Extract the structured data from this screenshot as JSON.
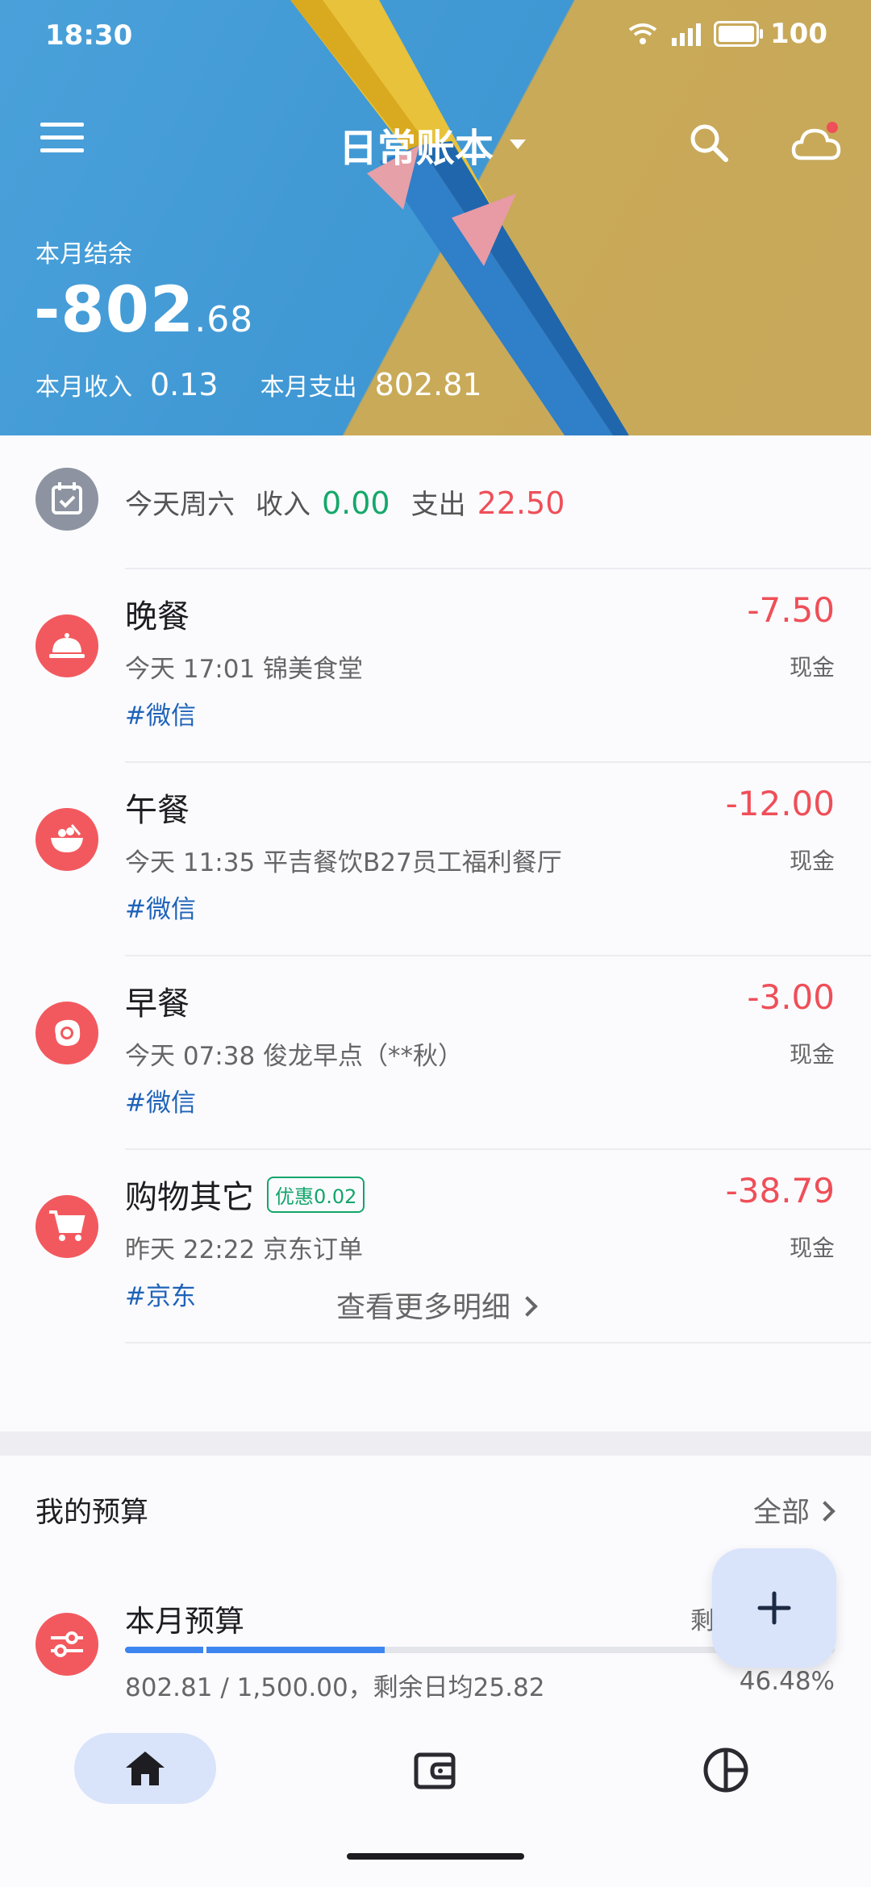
{
  "status": {
    "time": "18:30",
    "battery": "100"
  },
  "header": {
    "book_title": "日常账本",
    "balance_label": "本月结余",
    "balance_int": "-802",
    "balance_dec": ".68",
    "income_label": "本月收入",
    "income_value": "0.13",
    "expense_label": "本月支出",
    "expense_value": "802.81"
  },
  "today": {
    "label": "今天周六",
    "income_label": "收入",
    "income_value": "0.00",
    "expense_label": "支出",
    "expense_value": "22.50"
  },
  "transactions": [
    {
      "name": "晚餐",
      "sub": "今天 17:01 锦美食堂",
      "tag": "#微信",
      "amount": "-7.50",
      "account": "现金",
      "icon": "dome-icon"
    },
    {
      "name": "午餐",
      "sub": "今天 11:35 平吉餐饮B27员工福利餐厅",
      "tag": "#微信",
      "amount": "-12.00",
      "account": "现金",
      "icon": "bowl-icon"
    },
    {
      "name": "早餐",
      "sub": "今天 07:38 俊龙早点（**秋）",
      "tag": "#微信",
      "amount": "-3.00",
      "account": "现金",
      "icon": "egg-icon"
    },
    {
      "name": "购物其它",
      "coupon": "优惠0.02",
      "sub": "昨天 22:22 京东订单",
      "tag": "#京东",
      "amount": "-38.79",
      "account": "现金",
      "icon": "cart-icon"
    }
  ],
  "more_label": "查看更多明细",
  "budget": {
    "title": "我的预算",
    "all_label": "全部",
    "name": "本月预算",
    "remain_label": "剩",
    "progress_fraction": 0.3655,
    "time_fraction": 0.11,
    "amount_text": "802.81 / 1,500.00，剩余日均25.82",
    "percent": "46.48%"
  },
  "colors": {
    "expense": "#ef4f58",
    "income": "#15a86a",
    "tag": "#1f63b8",
    "accent": "#3d86ef"
  }
}
